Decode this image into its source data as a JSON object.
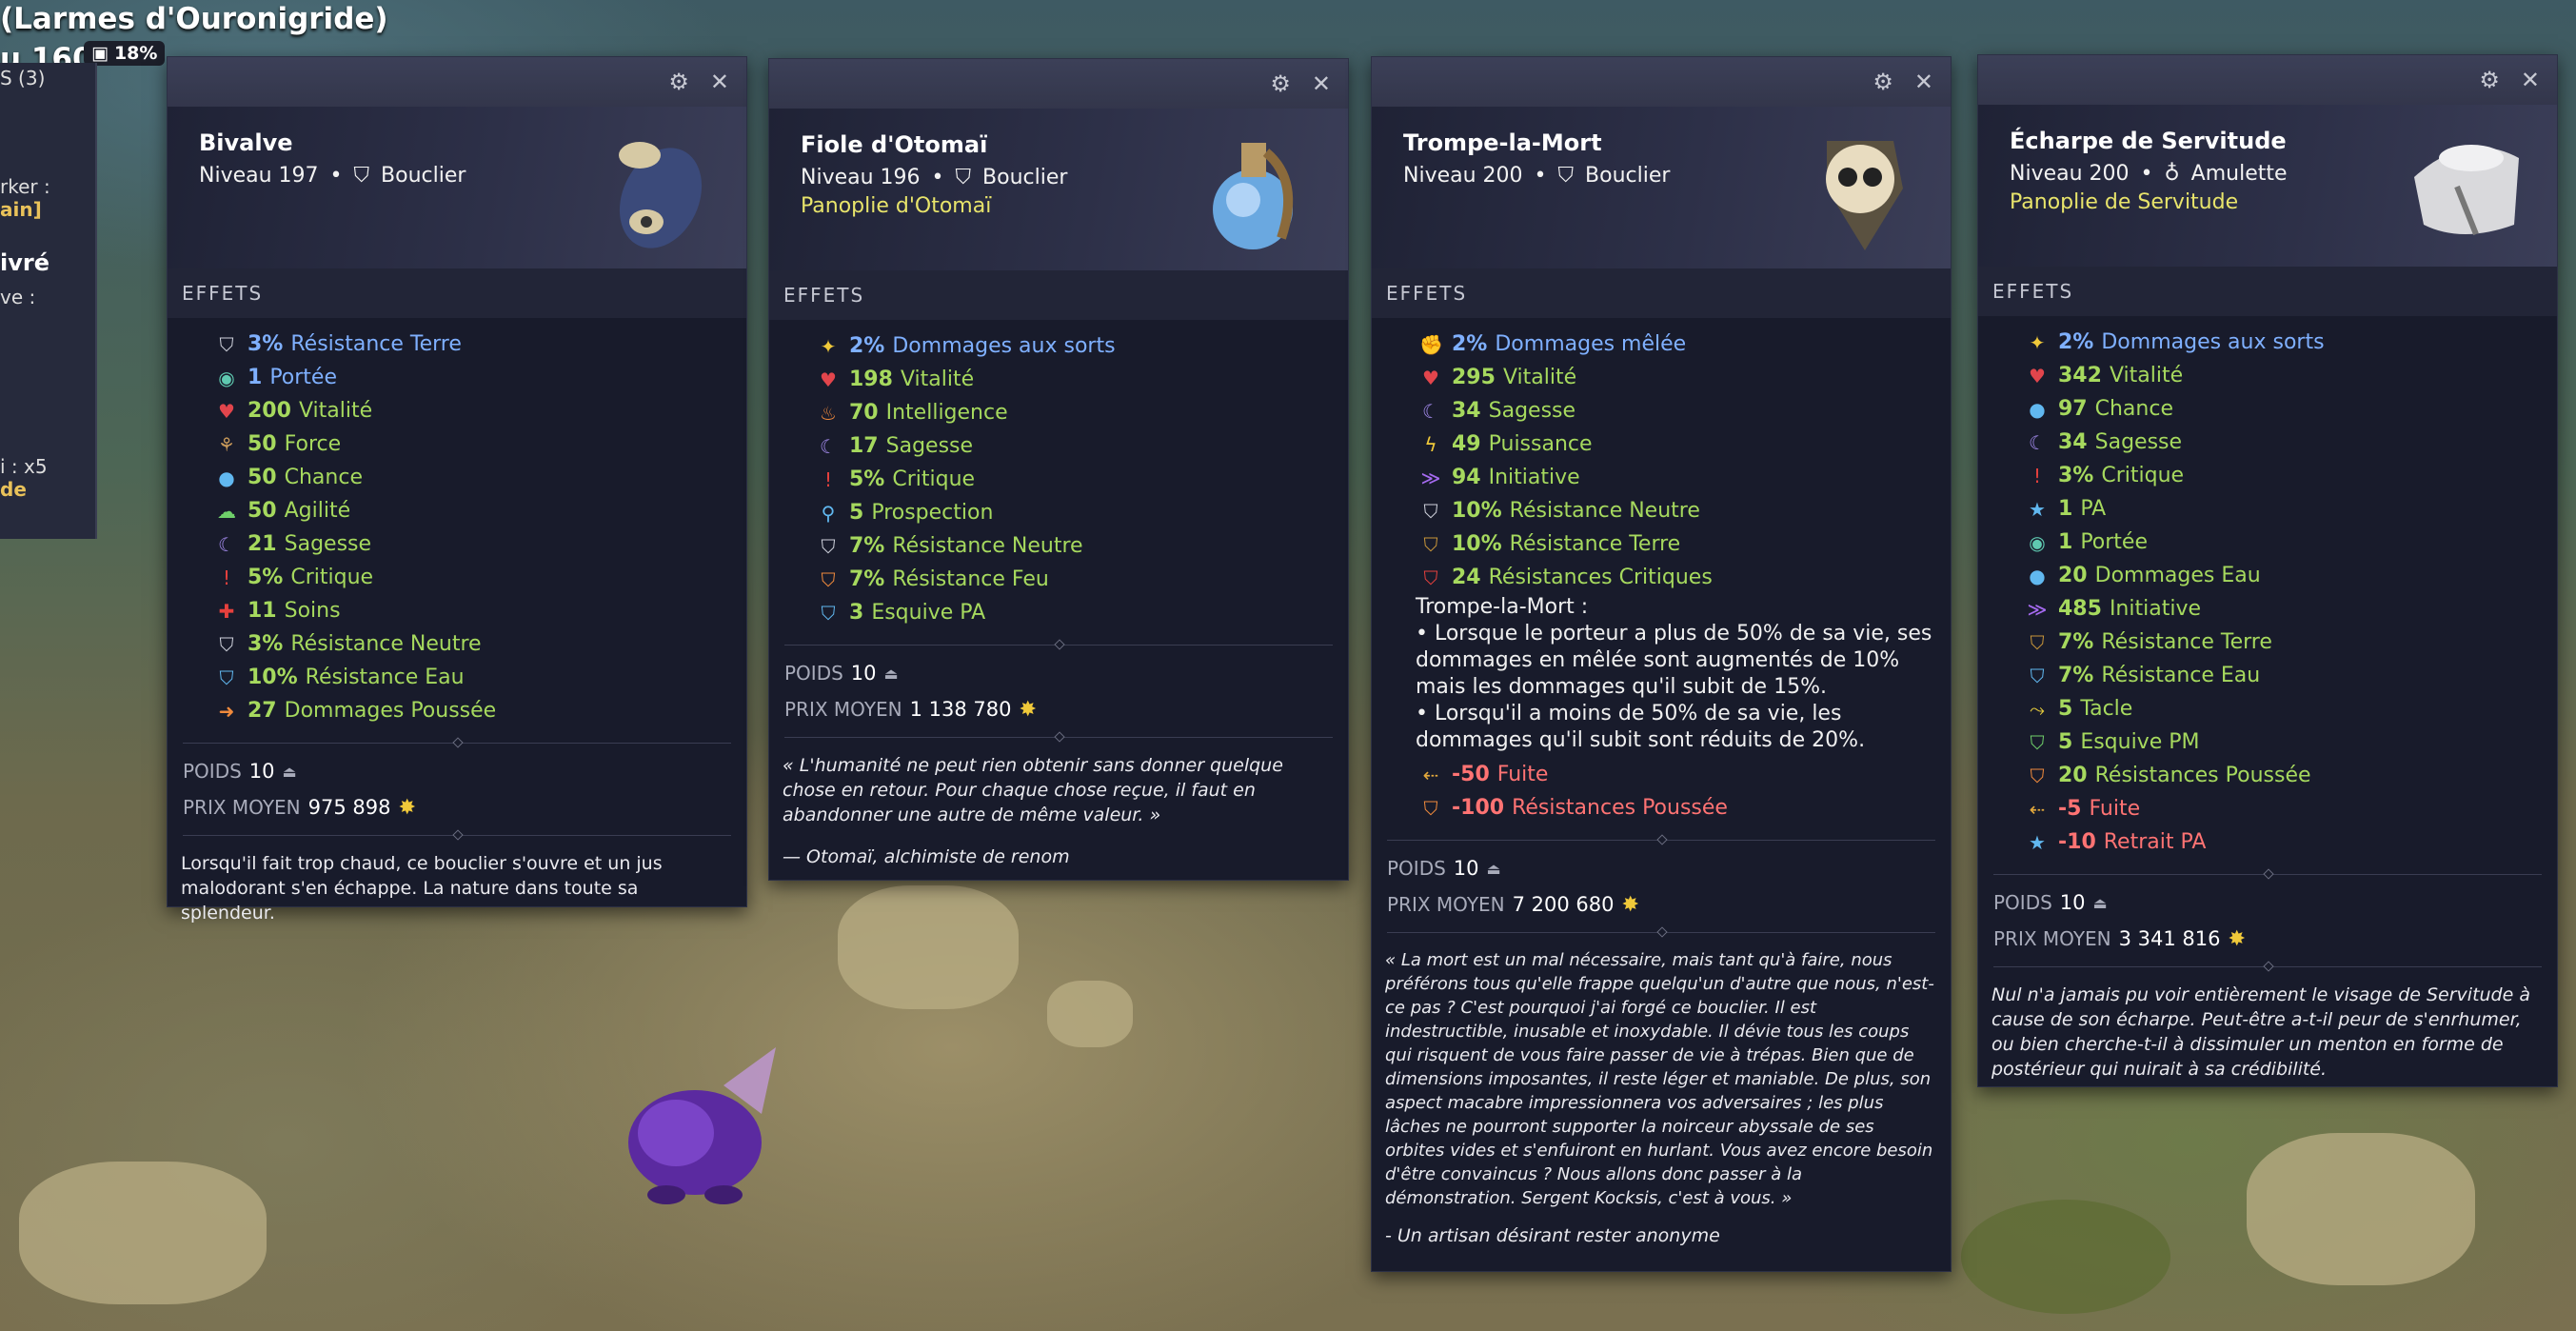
{
  "hud": {
    "area_title": "(Larmes d'Ouronigride)",
    "level_partial": "u 160",
    "badge_value": "18%",
    "side_lines": [
      "S (3)",
      "rker :",
      "ain]",
      "ivré",
      "ve :",
      "i : x5",
      "de"
    ]
  },
  "cards": [
    {
      "name": "Bivalve",
      "level": "Niveau 197",
      "type": "Bouclier",
      "type_icon": "shield-icon",
      "set": "",
      "effects_title": "EFFETS",
      "effects": [
        {
          "icon": "neutral-resist-icon",
          "value": "3%",
          "label": "Résistance Terre",
          "color": "blue"
        },
        {
          "icon": "range-icon",
          "value": "1",
          "label": "Portée",
          "color": "blue"
        },
        {
          "icon": "heart-icon",
          "value": "200",
          "label": "Vitalité",
          "color": "green"
        },
        {
          "icon": "strength-icon",
          "value": "50",
          "label": "Force",
          "color": "green"
        },
        {
          "icon": "water-drop-icon",
          "value": "50",
          "label": "Chance",
          "color": "green"
        },
        {
          "icon": "agility-icon",
          "value": "50",
          "label": "Agilité",
          "color": "green"
        },
        {
          "icon": "wisdom-icon",
          "value": "21",
          "label": "Sagesse",
          "color": "green"
        },
        {
          "icon": "critical-icon",
          "value": "5%",
          "label": "Critique",
          "color": "green"
        },
        {
          "icon": "heal-icon",
          "value": "11",
          "label": "Soins",
          "color": "green"
        },
        {
          "icon": "neutral-resist-icon",
          "value": "3%",
          "label": "Résistance Neutre",
          "color": "green"
        },
        {
          "icon": "water-resist-icon",
          "value": "10%",
          "label": "Résistance Eau",
          "color": "green"
        },
        {
          "icon": "push-damage-icon",
          "value": "27",
          "label": "Dommages Poussée",
          "color": "green"
        }
      ],
      "extra_lines": [],
      "weight_label": "POIDS",
      "weight": "10",
      "price_label": "PRIX MOYEN",
      "price": "975 898",
      "description": "Lorsqu'il fait trop chaud, ce bouclier s'ouvre et un jus malodorant s'en échappe. La nature dans toute sa splendeur.",
      "desc_italic": false,
      "author": ""
    },
    {
      "name": "Fiole d'Otomaï",
      "level": "Niveau 196",
      "type": "Bouclier",
      "type_icon": "shield-icon",
      "set": "Panoplie d'Otomaï",
      "effects_title": "EFFETS",
      "effects": [
        {
          "icon": "spell-damage-icon",
          "value": "2%",
          "label": "Dommages aux sorts",
          "color": "blue"
        },
        {
          "icon": "heart-icon",
          "value": "198",
          "label": "Vitalité",
          "color": "green"
        },
        {
          "icon": "fire-icon",
          "value": "70",
          "label": "Intelligence",
          "color": "green"
        },
        {
          "icon": "wisdom-icon",
          "value": "17",
          "label": "Sagesse",
          "color": "green"
        },
        {
          "icon": "critical-icon",
          "value": "5%",
          "label": "Critique",
          "color": "green"
        },
        {
          "icon": "prospecting-icon",
          "value": "5",
          "label": "Prospection",
          "color": "green"
        },
        {
          "icon": "neutral-resist-icon",
          "value": "7%",
          "label": "Résistance Neutre",
          "color": "green"
        },
        {
          "icon": "fire-resist-icon",
          "value": "7%",
          "label": "Résistance Feu",
          "color": "green"
        },
        {
          "icon": "ap-dodge-icon",
          "value": "3",
          "label": "Esquive PA",
          "color": "green"
        }
      ],
      "extra_lines": [],
      "weight_label": "POIDS",
      "weight": "10",
      "price_label": "PRIX MOYEN",
      "price": "1 138 780",
      "description": "« L'humanité ne peut rien obtenir sans donner quelque chose en retour. Pour chaque chose reçue, il faut en abandonner une autre de même valeur. »",
      "desc_italic": true,
      "author": "— Otomaï, alchimiste de renom"
    },
    {
      "name": "Trompe-la-Mort",
      "level": "Niveau 200",
      "type": "Bouclier",
      "type_icon": "shield-icon",
      "set": "",
      "effects_title": "EFFETS",
      "effects": [
        {
          "icon": "melee-damage-icon",
          "value": "2%",
          "label": "Dommages mêlée",
          "color": "blue"
        },
        {
          "icon": "heart-icon",
          "value": "295",
          "label": "Vitalité",
          "color": "green"
        },
        {
          "icon": "wisdom-icon",
          "value": "34",
          "label": "Sagesse",
          "color": "green"
        },
        {
          "icon": "power-icon",
          "value": "49",
          "label": "Puissance",
          "color": "green"
        },
        {
          "icon": "initiative-icon",
          "value": "94",
          "label": "Initiative",
          "color": "green"
        },
        {
          "icon": "neutral-resist-icon",
          "value": "10%",
          "label": "Résistance Neutre",
          "color": "green"
        },
        {
          "icon": "earth-resist-icon",
          "value": "10%",
          "label": "Résistance Terre",
          "color": "green"
        },
        {
          "icon": "crit-resist-icon",
          "value": "24",
          "label": "Résistances Critiques",
          "color": "green"
        }
      ],
      "extra_lines": [
        "Trompe-la-Mort :",
        "• Lorsque le porteur a plus de 50% de sa vie, ses dommages en mêlée sont augmentés de 10% mais les dommages qu'il subit de 15%.",
        "• Lorsqu'il a moins de 50% de sa vie, les dommages qu'il subit sont réduits de 20%."
      ],
      "effects_after": [
        {
          "icon": "flee-icon",
          "value": "-50",
          "label": "Fuite",
          "color": "red"
        },
        {
          "icon": "push-resist-icon",
          "value": "-100",
          "label": "Résistances Poussée",
          "color": "red"
        }
      ],
      "weight_label": "POIDS",
      "weight": "10",
      "price_label": "PRIX MOYEN",
      "price": "7 200 680",
      "description": "« La mort est un mal nécessaire, mais tant qu'à faire, nous préférons tous qu'elle frappe quelqu'un d'autre que nous, n'est-ce pas ? C'est pourquoi j'ai forgé ce bouclier. Il est indestructible, inusable et inoxydable. Il dévie tous les coups qui risquent de vous faire passer de vie à trépas. Bien que de dimensions imposantes, il reste léger et maniable. De plus, son aspect macabre impressionnera vos adversaires ; les plus lâches ne pourront supporter la noirceur abyssale de ses orbites vides et s'enfuiront en hurlant. Vous avez encore besoin d'être convaincus ? Nous allons donc passer à la démonstration. Sergent Kocksis, c'est à vous. »",
      "desc_italic": true,
      "author": "- Un artisan désirant rester anonyme"
    },
    {
      "name": "Écharpe de Servitude",
      "level": "Niveau 200",
      "type": "Amulette",
      "type_icon": "amulet-icon",
      "set": "Panoplie de Servitude",
      "effects_title": "EFFETS",
      "effects": [
        {
          "icon": "spell-damage-icon",
          "value": "2%",
          "label": "Dommages aux sorts",
          "color": "blue"
        },
        {
          "icon": "heart-icon",
          "value": "342",
          "label": "Vitalité",
          "color": "green"
        },
        {
          "icon": "water-drop-icon",
          "value": "97",
          "label": "Chance",
          "color": "green"
        },
        {
          "icon": "wisdom-icon",
          "value": "34",
          "label": "Sagesse",
          "color": "green"
        },
        {
          "icon": "critical-icon",
          "value": "3%",
          "label": "Critique",
          "color": "green"
        },
        {
          "icon": "ap-star-icon",
          "value": "1",
          "label": "PA",
          "color": "green"
        },
        {
          "icon": "range-icon",
          "value": "1",
          "label": "Portée",
          "color": "green"
        },
        {
          "icon": "water-drop-icon",
          "value": "20",
          "label": "Dommages Eau",
          "color": "green"
        },
        {
          "icon": "initiative-icon",
          "value": "485",
          "label": "Initiative",
          "color": "green"
        },
        {
          "icon": "earth-resist-icon",
          "value": "7%",
          "label": "Résistance Terre",
          "color": "green"
        },
        {
          "icon": "water-resist-icon",
          "value": "7%",
          "label": "Résistance Eau",
          "color": "green"
        },
        {
          "icon": "lock-icon",
          "value": "5",
          "label": "Tacle",
          "color": "green"
        },
        {
          "icon": "mp-dodge-icon",
          "value": "5",
          "label": "Esquive PM",
          "color": "green"
        },
        {
          "icon": "push-resist-icon",
          "value": "20",
          "label": "Résistances Poussée",
          "color": "green"
        },
        {
          "icon": "flee-icon",
          "value": "-5",
          "label": "Fuite",
          "color": "red"
        },
        {
          "icon": "ap-reduction-icon",
          "value": "-10",
          "label": "Retrait PA",
          "color": "red"
        }
      ],
      "extra_lines": [],
      "weight_label": "POIDS",
      "weight": "10",
      "price_label": "PRIX MOYEN",
      "price": "3 341 816",
      "description": "Nul n'a jamais pu voir entièrement le visage de Servitude à cause de son écharpe. Peut-être a-t-il peur de s'enrhumer, ou bien cherche-t-il à dissimuler un menton en forme de postérieur qui nuirait à sa crédibilité.",
      "desc_italic": true,
      "author": ""
    }
  ],
  "colors": {
    "green": "#a6d95e",
    "blue": "#7fb0ff",
    "red": "#ff7373",
    "set_yellow": "#e8e46b",
    "kama": "#f0c93a"
  }
}
